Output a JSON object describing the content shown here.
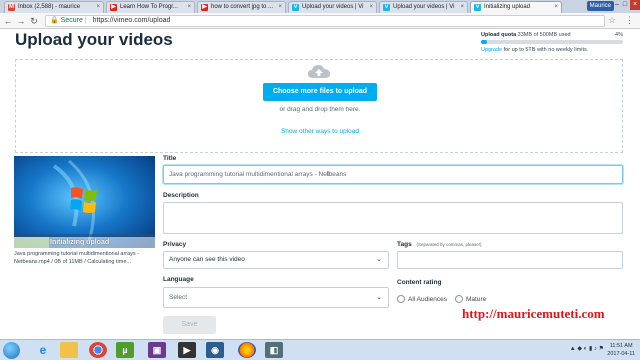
{
  "browser": {
    "tabs": [
      {
        "label": "Inbox (2,588) - maurice",
        "icon": "gmail-icon",
        "color": "#d44638",
        "active": false
      },
      {
        "label": "Learn How To Progr...",
        "icon": "youtube-icon",
        "color": "#e62117",
        "active": false
      },
      {
        "label": "how to convert jpg to ...",
        "icon": "youtube-icon",
        "color": "#e62117",
        "active": false
      },
      {
        "label": "Upload your videos | Vi",
        "icon": "vimeo-icon",
        "color": "#1ab7ea",
        "active": false
      },
      {
        "label": "Upload your videos | Vi",
        "icon": "vimeo-icon",
        "color": "#1ab7ea",
        "active": false
      },
      {
        "label": "Initializing upload",
        "icon": "vimeo-icon",
        "color": "#1ab7ea",
        "active": true
      }
    ],
    "profile": "Maurice",
    "secure_label": "Secure",
    "url": "https://vimeo.com/upload"
  },
  "page": {
    "title": "Upload your videos",
    "quota": {
      "label": "Upload quota",
      "detail": "33MB of 500MB used",
      "percent_label": "4%",
      "percent": 4,
      "upgrade_link": "Upgrade",
      "upgrade_text": "for up to 5TB with no weekly limits."
    },
    "dropzone": {
      "choose_button": "Choose more files to upload",
      "drag_text": "or drag and drop them here.",
      "other_ways": "Show other ways to upload"
    },
    "upload": {
      "status": "Initializing upload",
      "progress": 0,
      "file_info": "Java programming tutorial multidimentional arrays - Netbeans.mp4 / 0B of 11MB / Calculating time..."
    },
    "form": {
      "title_label": "Title",
      "title_value": "Java programming tutorial multidimentional arrays - Netbeans",
      "description_label": "Description",
      "privacy_label": "Privacy",
      "privacy_value": "Anyone can see this video",
      "tags_label": "Tags",
      "tags_hint": "(Separated by commas, please!)",
      "language_label": "Language",
      "language_placeholder": "Select",
      "content_rating_label": "Content rating",
      "rating_all": "All Audiences",
      "rating_mature": "Mature",
      "save_button": "Save"
    },
    "watermark": "http://mauricemuteti.com"
  },
  "taskbar": {
    "time": "11:51 AM",
    "date": "2017-04-11"
  }
}
